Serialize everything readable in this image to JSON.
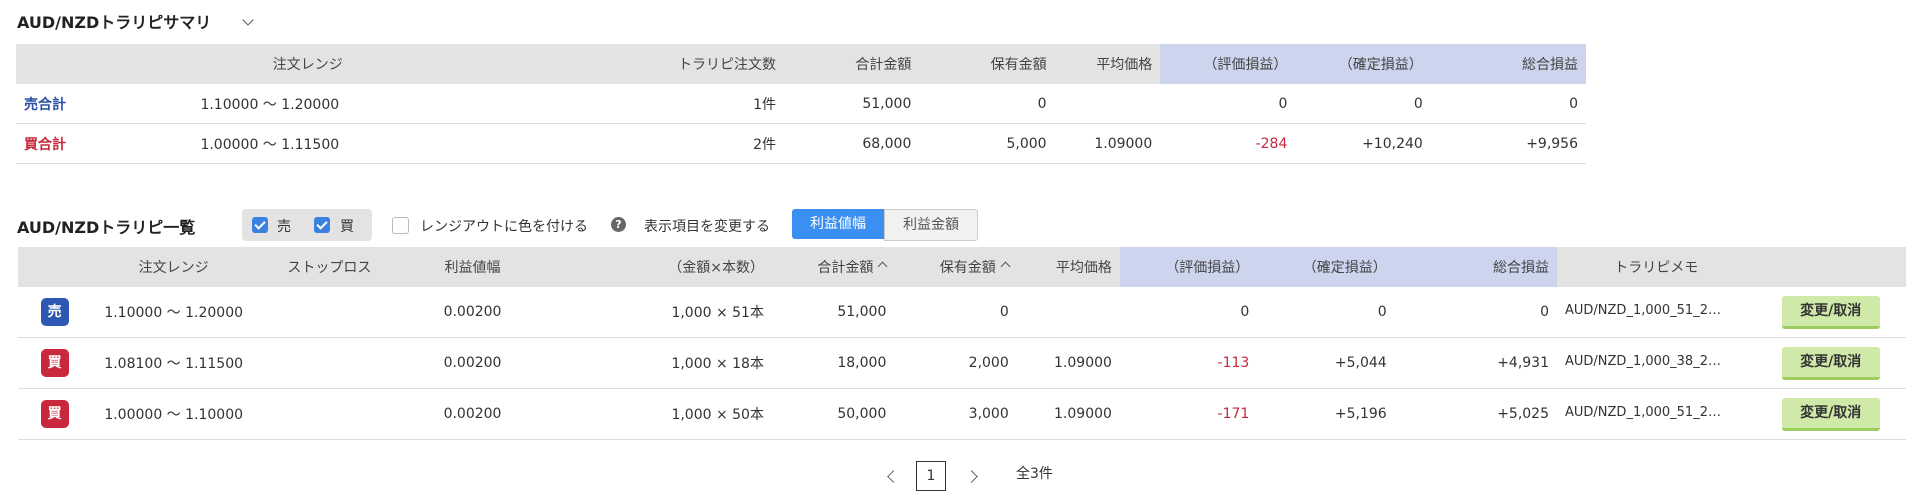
{
  "summary": {
    "title": "AUD/NZDトラリピサマリ",
    "headers": [
      "注文レンジ",
      "トラリピ注文数",
      "合計金額",
      "保有金額",
      "平均価格",
      "（評価損益）",
      "（確定損益）",
      "総合損益"
    ],
    "rows": [
      {
        "label": "売合計",
        "side": "sell",
        "range": "1.10000 〜 1.20000",
        "orders": "1件",
        "total": "51,000",
        "held": "0",
        "avg": "",
        "unrealized": "0",
        "realized": "0",
        "net": "0"
      },
      {
        "label": "買合計",
        "side": "buy",
        "range": "1.00000 〜 1.11500",
        "orders": "2件",
        "total": "68,000",
        "held": "5,000",
        "avg": "1.09000",
        "unrealized": "-284",
        "realized": "+10,240",
        "net": "+9,956"
      }
    ]
  },
  "list": {
    "title": "AUD/NZDトラリピ一覧",
    "filter_sell": "売",
    "filter_buy": "買",
    "color_option": "レンジアウトに色を付ける",
    "display_label": "表示項目を変更する",
    "toggle_on": "利益値幅",
    "toggle_off": "利益金額",
    "headers": [
      "注文レンジ",
      "ストップロス",
      "利益値幅",
      "（金額×本数）",
      "合計金額",
      "保有金額",
      "平均価格",
      "（評価損益）",
      "（確定損益）",
      "総合損益",
      "トラリピメモ"
    ],
    "rows": [
      {
        "badge": "売",
        "side": "sell",
        "range": "1.10000 〜 1.20000",
        "stop": "",
        "width": "0.00200",
        "amount": "1,000 × 51本",
        "total": "51,000",
        "held": "0",
        "avg": "",
        "unrealized": "0",
        "realized": "0",
        "net": "0",
        "memo": "AUD/NZD_1,000_51_2…",
        "action": "変更/取消"
      },
      {
        "badge": "買",
        "side": "buy",
        "range": "1.08100 〜 1.11500",
        "stop": "",
        "width": "0.00200",
        "amount": "1,000 × 18本",
        "total": "18,000",
        "held": "2,000",
        "avg": "1.09000",
        "unrealized": "-113",
        "realized": "+5,044",
        "net": "+4,931",
        "memo": "AUD/NZD_1,000_38_2…",
        "action": "変更/取消"
      },
      {
        "badge": "買",
        "side": "buy",
        "range": "1.00000 〜 1.10000",
        "stop": "",
        "width": "0.00200",
        "amount": "1,000 × 50本",
        "total": "50,000",
        "held": "3,000",
        "avg": "1.09000",
        "unrealized": "-171",
        "realized": "+5,196",
        "net": "+5,025",
        "memo": "AUD/NZD_1,000_51_2…",
        "action": "変更/取消"
      }
    ]
  },
  "pagination": {
    "current": "1",
    "total": "全3件"
  },
  "colors": {
    "sell": "#2c57b3",
    "buy": "#c8283c",
    "accent": "#3b8ff0",
    "button": "#cfe9a8"
  }
}
